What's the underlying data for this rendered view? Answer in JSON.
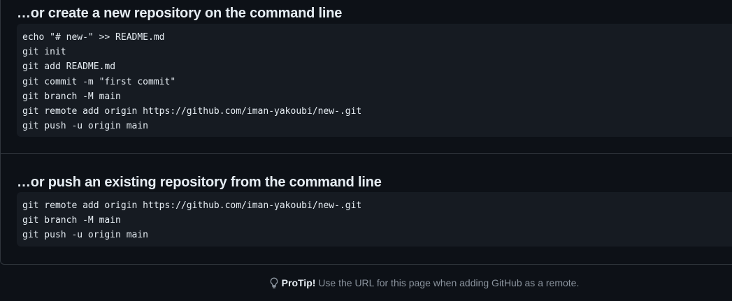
{
  "new_repo": {
    "heading": "…or create a new repository on the command line",
    "lines": [
      "echo \"# new-\" >> README.md",
      "git init",
      "git add README.md",
      "git commit -m \"first commit\"",
      "git branch -M main",
      "git remote add origin https://github.com/iman-yakoubi/new-.git",
      "git push -u origin main"
    ]
  },
  "existing_repo": {
    "heading": "…or push an existing repository from the command line",
    "lines": [
      "git remote add origin https://github.com/iman-yakoubi/new-.git",
      "git branch -M main",
      "git push -u origin main"
    ]
  },
  "protip": {
    "icon": "lightbulb-icon",
    "label": "ProTip!",
    "text": " Use the URL for this page when adding GitHub as a remote."
  }
}
